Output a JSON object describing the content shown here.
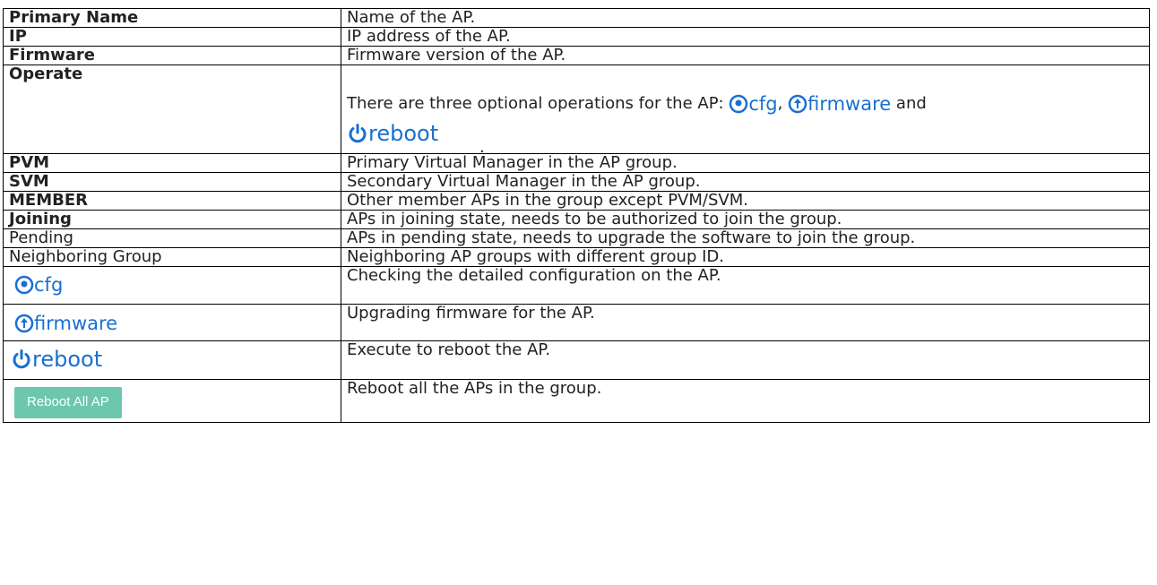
{
  "rows": [
    {
      "term": "Primary Name",
      "desc": "Name of the AP."
    },
    {
      "term": "IP",
      "desc": "IP address of the AP."
    },
    {
      "term": "Firmware",
      "desc": "Firmware version of the AP."
    },
    {
      "term": "Operate",
      "desc_pre": "There are three optional operations for the AP: ",
      "comma": ",",
      "and": "and",
      "period": "."
    },
    {
      "term": "PVM",
      "desc": "Primary Virtual Manager in the AP group."
    },
    {
      "term": "SVM",
      "desc": "Secondary Virtual Manager in the AP group."
    },
    {
      "term": "MEMBER",
      "desc": "Other member APs in the group except PVM/SVM."
    },
    {
      "term": "Joining",
      "desc": "APs in joining state, needs to be authorized to join the group."
    },
    {
      "term": "Pending",
      "desc": "APs in pending state, needs to upgrade the software to join the group."
    },
    {
      "term": "Neighboring Group",
      "desc": "Neighboring AP groups with different group ID."
    },
    {
      "desc": "Checking the detailed configuration on the AP."
    },
    {
      "desc": "Upgrading firmware for the AP."
    },
    {
      "desc": "Execute to reboot the AP."
    },
    {
      "desc": "Reboot all the APs in the group."
    }
  ],
  "badges": {
    "cfg": "cfg",
    "firmware": "firmware",
    "reboot": "reboot",
    "reboot_all": "Reboot All AP"
  },
  "icons": {
    "cfg": "eye-icon",
    "firmware": "arrow-up-circle-icon",
    "reboot": "power-icon"
  },
  "colors": {
    "link_blue": "#1a6fd1",
    "button_green": "#6cc7ad"
  }
}
